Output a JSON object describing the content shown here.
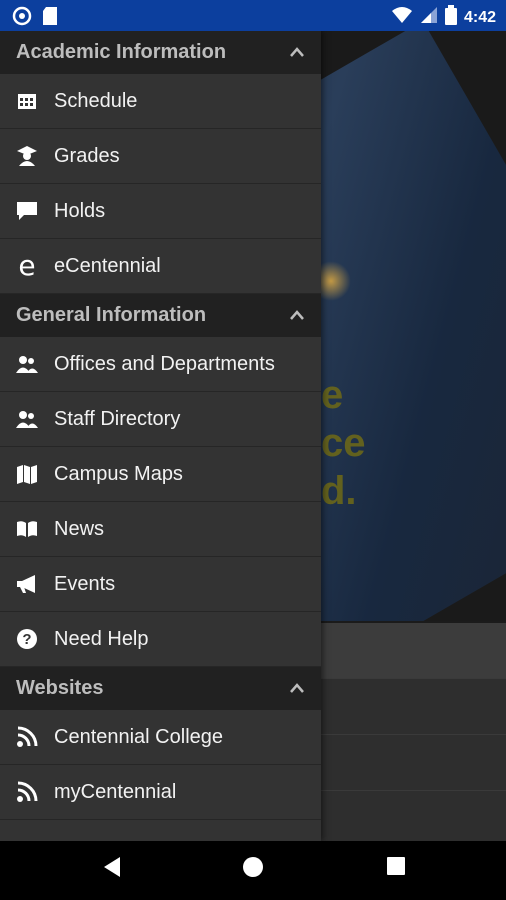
{
  "status_bar": {
    "time": "4:42"
  },
  "drawer": {
    "sections": [
      {
        "title": "Academic Information",
        "items": [
          {
            "label": "Schedule",
            "icon": "calendar-icon"
          },
          {
            "label": "Grades",
            "icon": "graduate-icon"
          },
          {
            "label": "Holds",
            "icon": "chat-bubble-icon"
          },
          {
            "label": "eCentennial",
            "icon": "e-letter-icon",
            "glyph": "e"
          }
        ]
      },
      {
        "title": "General Information",
        "items": [
          {
            "label": "Offices and Departments",
            "icon": "people-icon"
          },
          {
            "label": "Staff Directory",
            "icon": "people-icon"
          },
          {
            "label": "Campus Maps",
            "icon": "map-icon"
          },
          {
            "label": "News",
            "icon": "book-icon"
          },
          {
            "label": "Events",
            "icon": "megaphone-icon"
          },
          {
            "label": "Need Help",
            "icon": "help-icon"
          }
        ]
      },
      {
        "title": "Websites",
        "items": [
          {
            "label": "Centennial College",
            "icon": "rss-icon"
          },
          {
            "label": "myCentennial",
            "icon": "rss-icon"
          }
        ]
      }
    ]
  },
  "background": {
    "ghost_text": [
      "e",
      "ce",
      "d."
    ]
  },
  "colors": {
    "status_bar": "#0c3f9e",
    "drawer": "#333333",
    "section_header": "#212121"
  }
}
